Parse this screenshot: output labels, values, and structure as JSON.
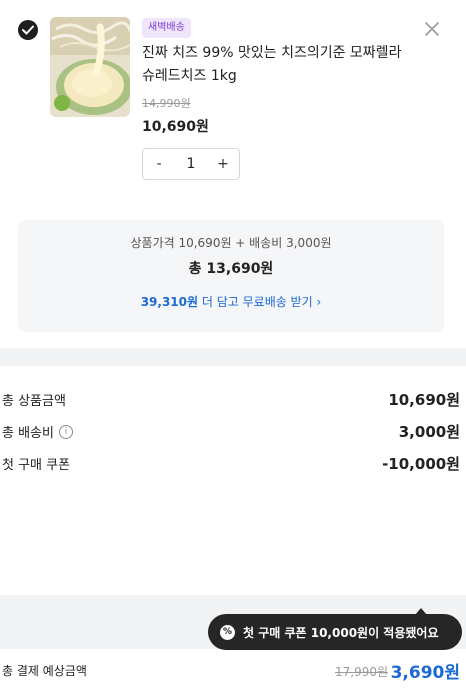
{
  "item": {
    "checked": true,
    "badge": "새벽배송",
    "title": "진짜 치즈 99% 맛있는 치즈의기준 모짜렐라 슈레드치즈 1kg",
    "original_price": "14,990원",
    "sale_price": "10,690원",
    "quantity": "1",
    "minus": "-",
    "plus": "+"
  },
  "summary": {
    "line1": "상품가격 10,690원 + 배송비 3,000원",
    "line2": "총 13,690원",
    "free_shipping_amount": "39,310원",
    "free_shipping_text": " 더 담고 무료배송 받기",
    "free_shipping_arrow": "›"
  },
  "details": {
    "product_total_label": "총 상품금액",
    "product_total_value": "10,690원",
    "shipping_label": "총 배송비",
    "shipping_info_icon": "i",
    "shipping_value": "3,000원",
    "coupon_label": "첫 구매 쿠폰",
    "coupon_value": "-10,000원"
  },
  "footer": {
    "label": "총 결제 예상금액",
    "original": "17,990원",
    "final": "3,690원"
  },
  "toast": {
    "icon": "%",
    "text": "첫 구매 쿠폰 10,000원이 적용됐어요"
  },
  "colors": {
    "accent": "#1b6ad3",
    "badge_bg": "#efe6fb",
    "badge_text": "#7b3fd0",
    "toast_bg": "#262626"
  },
  "icons": {
    "check": "check-circle-icon",
    "close": "close-icon",
    "info": "info-icon",
    "coupon": "discount-icon"
  }
}
